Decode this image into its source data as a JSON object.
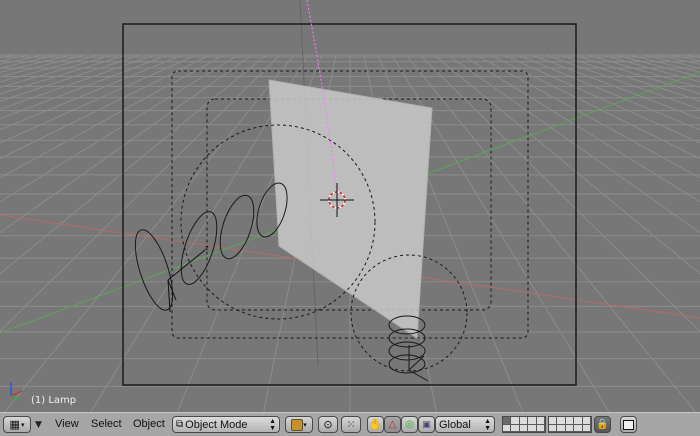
{
  "viewport": {
    "status": "(1) Lamp",
    "colors": {
      "background": "#777777",
      "grid": "#8a8a8a",
      "x_axis": "#b06060",
      "y_axis": "#5fa05f",
      "frame": "#111111",
      "plane": "#cfcfcf",
      "lamp_line": "#ff66ff"
    }
  },
  "header": {
    "editor_type_icon": "viewport-grid-icon",
    "menus": [
      "View",
      "Select",
      "Object"
    ],
    "mode": {
      "icon": "object-mode-icon",
      "value": "Object Mode"
    },
    "draw_type_icon": "draw-type-icon",
    "view_icons": [
      "pivot-icon",
      "snap-icon"
    ],
    "manipulator_icons": [
      "hand-icon",
      "translate-icon",
      "rotate-icon",
      "scale-icon"
    ],
    "orientation": "Global",
    "lock_icon": "lock-icon",
    "render_icon": "render-icon"
  }
}
